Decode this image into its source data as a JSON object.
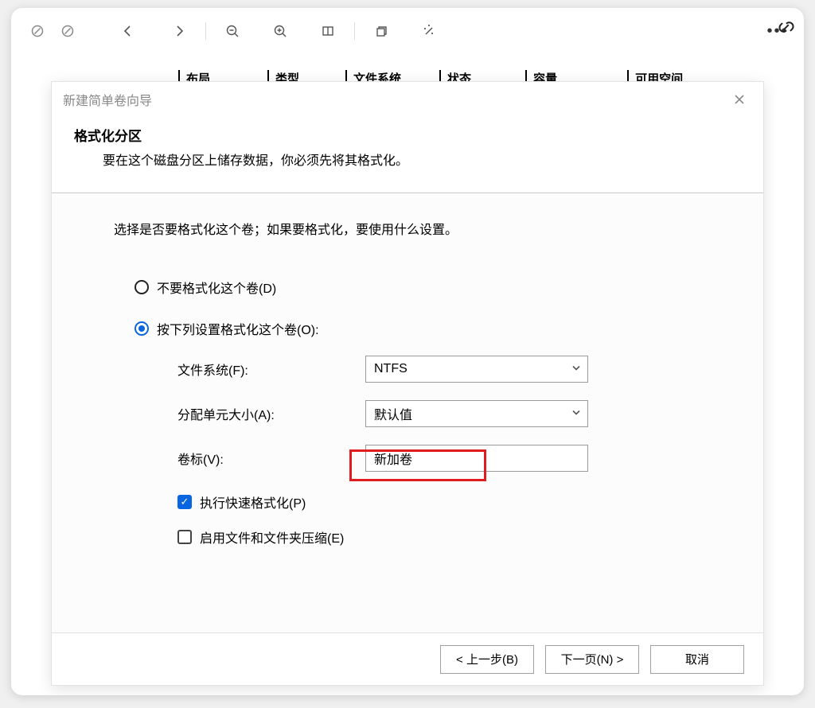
{
  "bg_headers": [
    "布局",
    "类型",
    "文件系统",
    "状态",
    "容量",
    "可用空间"
  ],
  "dialog": {
    "title": "新建简单卷向导",
    "hero_title": "格式化分区",
    "hero_sub": "要在这个磁盘分区上储存数据，你必须先将其格式化。",
    "body_intro": "选择是否要格式化这个卷；如果要格式化，要使用什么设置。",
    "radio_no_format": "不要格式化这个卷(D)",
    "radio_format": "按下列设置格式化这个卷(O):",
    "fields": {
      "filesystem_label": "文件系统(F):",
      "filesystem_value": "NTFS",
      "alloc_label": "分配单元大小(A):",
      "alloc_value": "默认值",
      "volume_label_label": "卷标(V):",
      "volume_label_value": "新加卷"
    },
    "quick_format": "执行快速格式化(P)",
    "enable_compress": "启用文件和文件夹压缩(E)",
    "buttons": {
      "back": "< 上一步(B)",
      "next": "下一页(N) >",
      "cancel": "取消"
    }
  }
}
